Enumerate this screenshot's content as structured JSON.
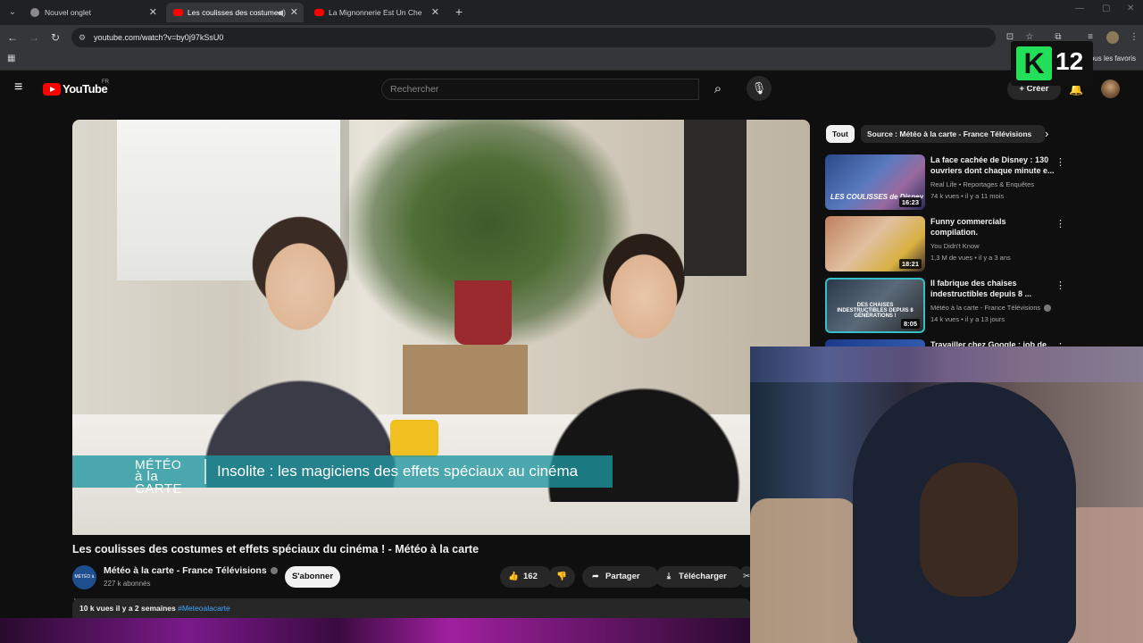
{
  "browser": {
    "tabs": [
      {
        "title": "Nouvel onglet",
        "active": false
      },
      {
        "title": "Les coulisses des costumes",
        "active": true
      },
      {
        "title": "La Mignonnerie Est Un Chef D'",
        "active": false
      }
    ],
    "url": "youtube.com/watch?v=by0j97kSsU0",
    "bookmarks_label": "Tous les favoris"
  },
  "header": {
    "logo_text": "YouTube",
    "country": "FR",
    "search_placeholder": "Rechercher",
    "create_label": "Créer"
  },
  "overlay_badge": {
    "letter": "K",
    "number": "12"
  },
  "video": {
    "lower_third_logo_line1": "MÉTÉO",
    "lower_third_logo_line2": "à la CARTE",
    "lower_third_text": "Insolite : les magiciens des effets spéciaux au cinéma",
    "title": "Les coulisses des costumes et effets spéciaux du cinéma ! - Météo à la carte"
  },
  "channel": {
    "name": "Météo à la carte - France Télévisions",
    "subscribers": "227 k abonnés",
    "avatar_text": "MÉTÉO à la CARTE",
    "subscribe_label": "S'abonner"
  },
  "actions": {
    "likes": "162",
    "share_label": "Partager",
    "download_label": "Télécharger"
  },
  "description": {
    "views_date": "10 k vues  il y a 2 semaines",
    "hashtag": "#Meteoalacarte"
  },
  "sidebar": {
    "chips": [
      "Tout",
      "Source : Météo à la carte - France Télévisions"
    ],
    "recommendations": [
      {
        "title": "La face cachée de Disney : 130 ouvriers dont chaque minute e...",
        "channel": "Real Life • Reportages & Enquêtes",
        "meta": "74 k vues • il y a 11 mois",
        "duration": "16:23",
        "thumb_label": "LES COULISSES de Disney"
      },
      {
        "title": "Funny commercials compilation.",
        "channel": "You Didn't Know",
        "meta": "1,3 M de vues • il y a 3 ans",
        "duration": "18:21",
        "thumb_label": ""
      },
      {
        "title": "Il fabrique des chaises indestructibles depuis 8 ...",
        "channel": "Météo à la carte - France Télévisions",
        "meta": "14 k vues • il y a 13 jours",
        "duration": "8:05",
        "thumb_label": "DES CHAISES INDESTRUCTIBLES DEPUIS 8 GÉNÉRATIONS !"
      },
      {
        "title": "Travailler chez Google : job de",
        "channel": "",
        "meta": "",
        "duration": "",
        "thumb_label": ""
      }
    ]
  },
  "icons": {
    "menu": "hamburger-icon",
    "search": "search-icon",
    "mic": "mic-icon",
    "bell": "bell-icon",
    "like": "thumbs-up-icon",
    "dislike": "thumbs-down-icon",
    "share": "share-icon",
    "download": "download-icon"
  },
  "colors": {
    "accent": "#ff0000",
    "link": "#3ea6ff",
    "badge_green": "#22e05a"
  }
}
